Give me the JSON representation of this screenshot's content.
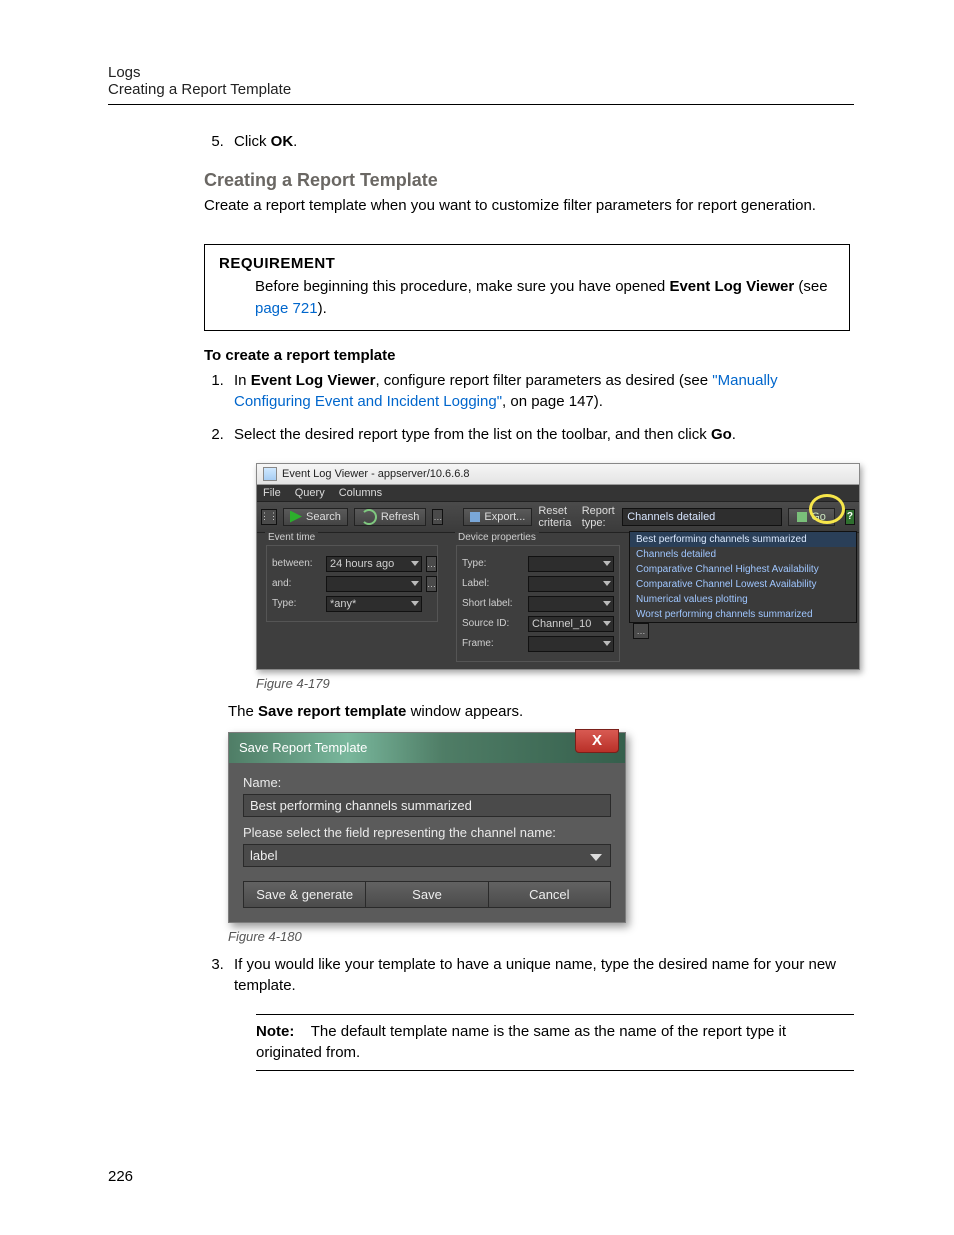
{
  "header": {
    "section": "Logs",
    "subsection": "Creating a Report Template"
  },
  "step5": {
    "pre": "Click ",
    "bold": "OK",
    "post": "."
  },
  "title": "Creating a Report Template",
  "desc": "Create a report template when you want to customize filter parameters for report generation.",
  "requirement": {
    "heading": "REQUIREMENT",
    "pre": "Before beginning this procedure, make sure you have opened ",
    "bold": "Event Log Viewer",
    "post1": " (see ",
    "link": "page 721",
    "post2": ")."
  },
  "sub": "To create a report template",
  "step1": {
    "a": "In ",
    "b": "Event Log Viewer",
    "c": ", configure report filter parameters as desired (see ",
    "link": "\"Manually Configuring Event and Incident Logging\"",
    "d": ", on page 147)."
  },
  "step2": {
    "a": "Select the desired report type from the list on the toolbar, and then click ",
    "b": "Go",
    "c": "."
  },
  "elv": {
    "title": "Event Log Viewer - appserver/10.6.6.8",
    "menus": [
      "File",
      "Query",
      "Columns"
    ],
    "search": "Search",
    "refresh": "Refresh",
    "export": "Export...",
    "reset": "Reset criteria",
    "reportTypeLabel": "Report type:",
    "reportSelected": "Channels detailed",
    "go": "Go",
    "help": "?",
    "eventTime": {
      "legend": "Event time",
      "between": "between:",
      "betweenVal": "24 hours ago",
      "and": "and:",
      "type": "Type:",
      "typeVal": "*any*"
    },
    "devProps": {
      "legend": "Device properties",
      "type": "Type:",
      "label": "Label:",
      "short": "Short label:",
      "src": "Source ID:",
      "srcVal": "Channel_10",
      "frame": "Frame:"
    },
    "options": [
      "Best performing channels summarized",
      "Channels detailed",
      "Comparative Channel Highest Availability",
      "Comparative Channel Lowest Availability",
      "Numerical values plotting",
      "Worst performing channels summarized"
    ]
  },
  "figcap1": "Figure 4-179",
  "afterFig1": {
    "a": "The ",
    "b": "Save report template",
    "c": " window appears."
  },
  "srt": {
    "title": "Save Report Template",
    "nameLabel": "Name:",
    "nameVal": "Best performing channels summarized",
    "fieldLabel": "Please select the field representing the channel name:",
    "fieldVal": "label",
    "b1": "Save & generate",
    "b2": "Save",
    "b3": "Cancel"
  },
  "figcap2": "Figure 4-180",
  "step3": "If you would like your template to have a unique name, type the desired name for your new template.",
  "note": {
    "label": "Note:",
    "body": "The default template name is the same as the name of the report type it originated from."
  },
  "pageNum": "226"
}
